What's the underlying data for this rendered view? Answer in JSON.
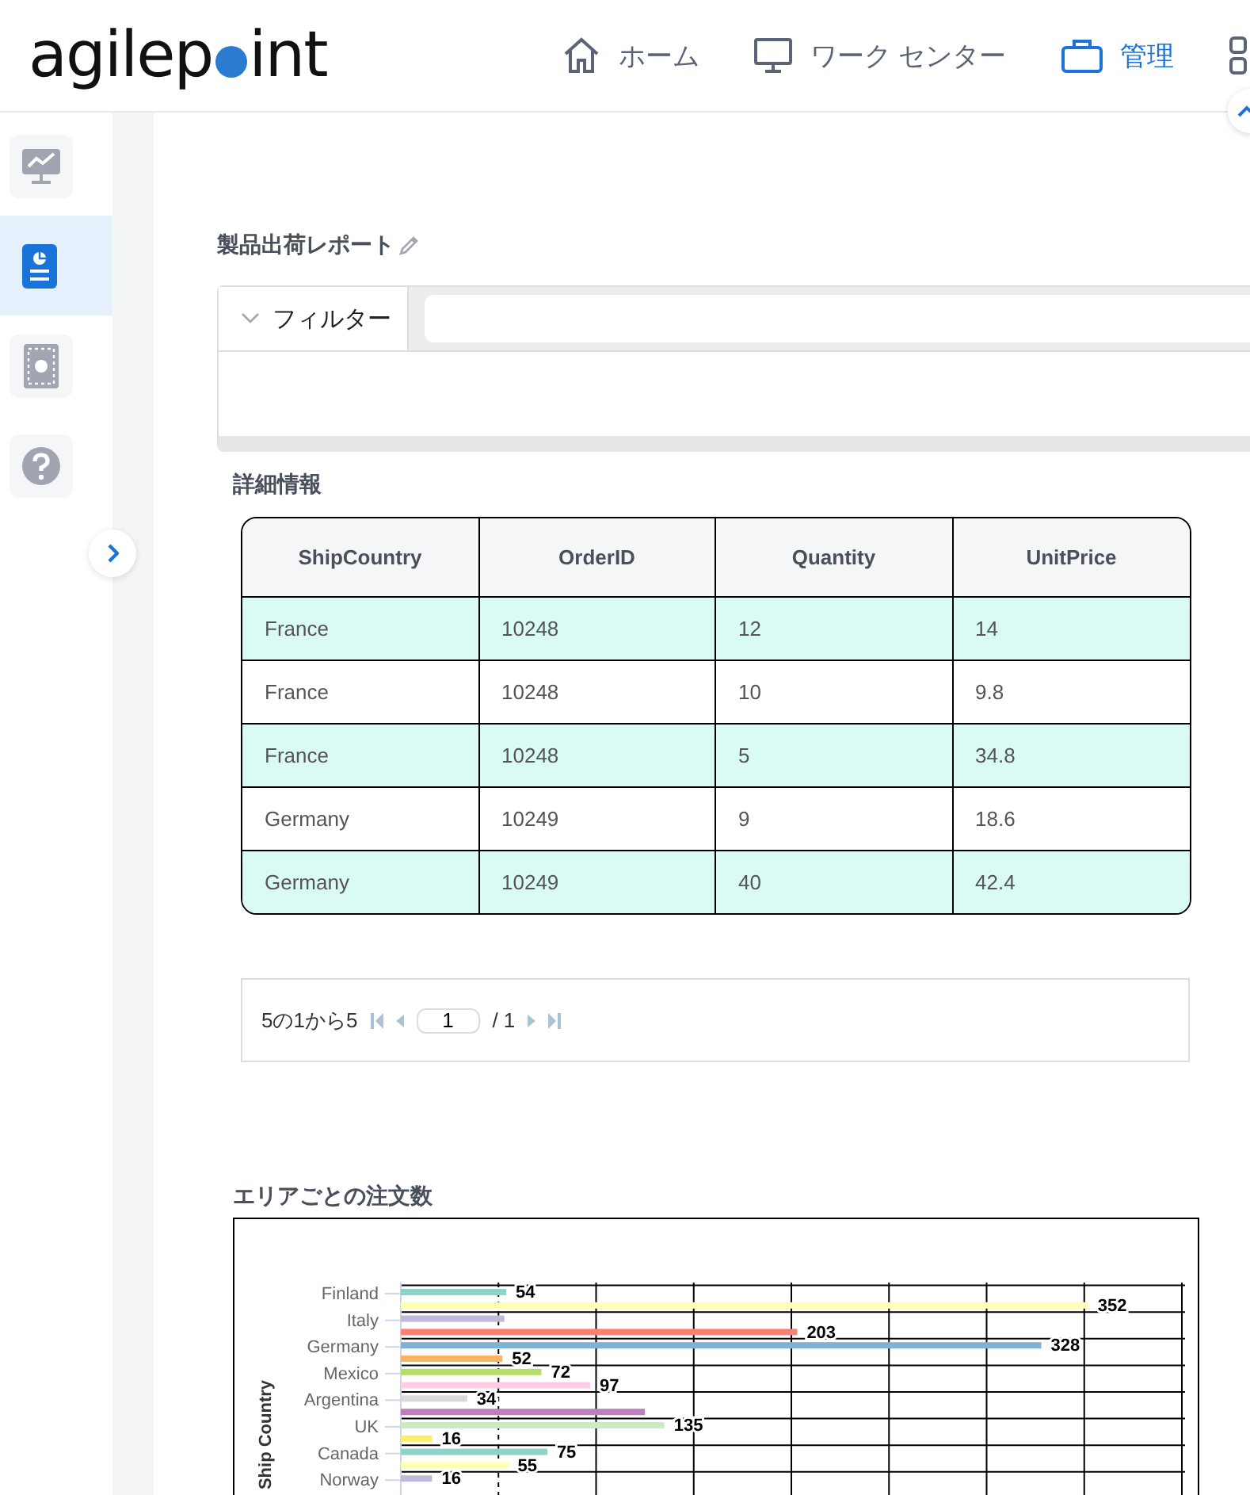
{
  "logo": {
    "before": "agilep",
    "after": "int"
  },
  "nav": [
    {
      "kind": "home",
      "label": "ホーム",
      "selected": false
    },
    {
      "kind": "monitor",
      "label": "ワーク センター",
      "selected": false
    },
    {
      "kind": "briefcase",
      "label": "管理",
      "selected": true
    },
    {
      "kind": "apps",
      "selected": false
    }
  ],
  "sidebar": {
    "items": [
      {
        "kind": "chart",
        "selected": false
      },
      {
        "kind": "report",
        "selected": true
      },
      {
        "kind": "dashboard",
        "selected": false
      },
      {
        "kind": "help",
        "selected": false
      }
    ]
  },
  "report": {
    "title": "製品出荷レポート",
    "filter": {
      "label": "フィルター"
    }
  },
  "details": {
    "title": "詳細情報",
    "columns": [
      "ShipCountry",
      "OrderID",
      "Quantity",
      "UnitPrice"
    ],
    "rows": [
      [
        "France",
        "10248",
        "12",
        "14"
      ],
      [
        "France",
        "10248",
        "10",
        "9.8"
      ],
      [
        "France",
        "10248",
        "5",
        "34.8"
      ],
      [
        "Germany",
        "10249",
        "9",
        "18.6"
      ],
      [
        "Germany",
        "10249",
        "40",
        "42.4"
      ]
    ],
    "pager": {
      "summary": "5の1から5",
      "page": "1",
      "total": "/ 1"
    }
  },
  "chart": {
    "title": "エリアごとの注文数",
    "ylabel": "Ship Country",
    "categories": [
      "Finland",
      "Italy",
      "Germany",
      "Mexico",
      "Argentina",
      "UK",
      "Canada",
      "Norway"
    ],
    "bars": [
      {
        "color": "#8dd3c7",
        "level": 0.135,
        "value_label": "54"
      },
      {
        "color": "#ffffb3",
        "level": 0.88,
        "value_label": "352"
      },
      {
        "color": "#bebada",
        "level": 0.1325
      },
      {
        "color": "#fb8072",
        "level": 0.5075,
        "value_label": "203"
      },
      {
        "color": "#80b1d3",
        "level": 0.82,
        "value_label": "328"
      },
      {
        "color": "#fdb462",
        "level": 0.13,
        "value_label": "52"
      },
      {
        "color": "#b3de69",
        "level": 0.18,
        "value_label": "72"
      },
      {
        "color": "#fccde5",
        "level": 0.2425,
        "value_label": "97"
      },
      {
        "color": "#d9d9d9",
        "level": 0.085,
        "value_label": "34"
      },
      {
        "color": "#bc80bd",
        "level": 0.3125
      },
      {
        "color": "#ccebc5",
        "level": 0.3375,
        "value_label": "135"
      },
      {
        "color": "#ffed6f",
        "level": 0.04,
        "value_label": "16"
      },
      {
        "color": "#8dd3c7",
        "level": 0.1875,
        "value_label": "75"
      },
      {
        "color": "#ffffb3",
        "level": 0.1375,
        "value_label": "55"
      },
      {
        "color": "#bebada",
        "level": 0.04,
        "value_label": "16"
      }
    ]
  }
}
